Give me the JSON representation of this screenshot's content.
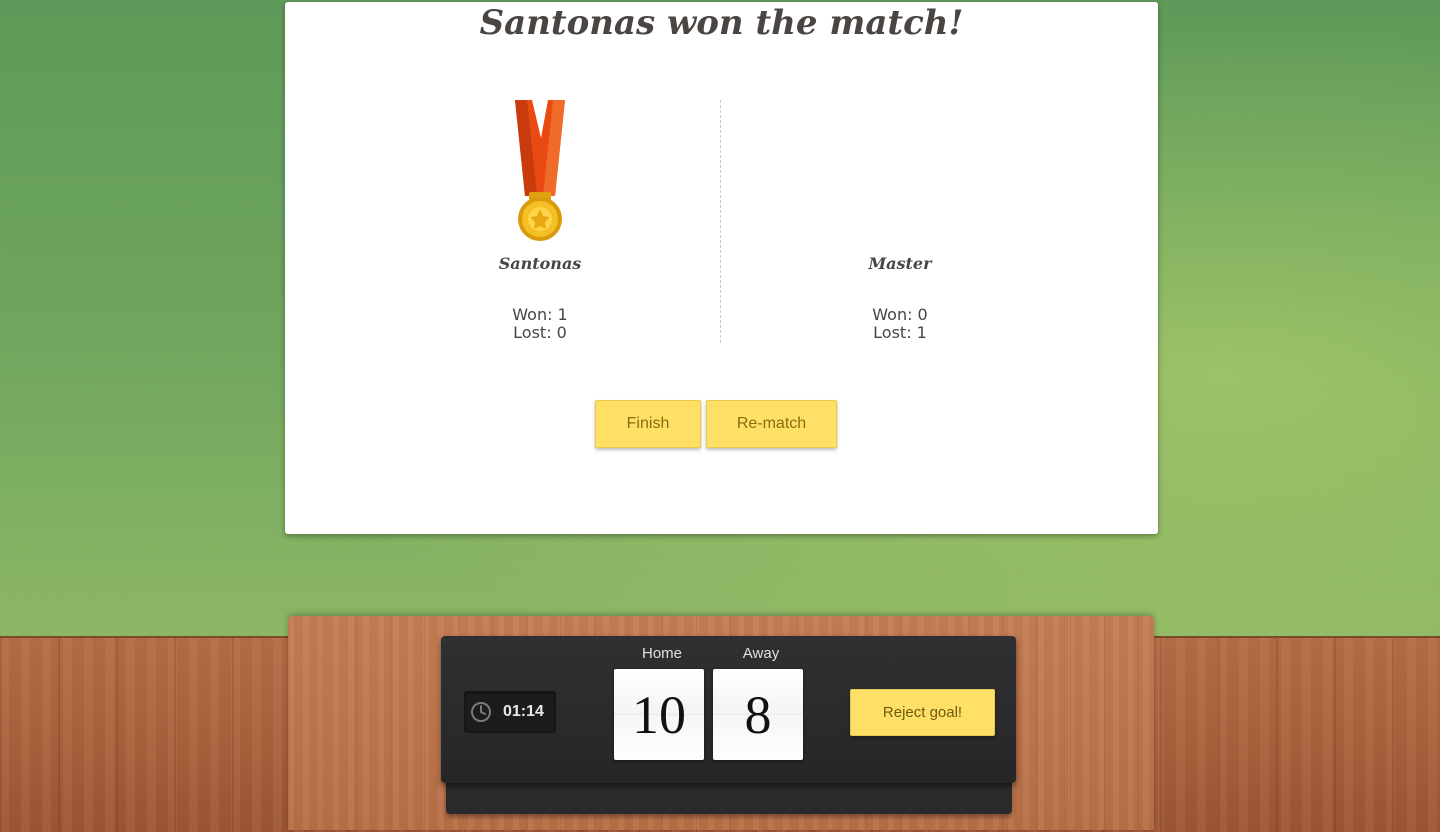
{
  "modal": {
    "title": "Santonas won the match!",
    "players": [
      {
        "name": "Santonas",
        "won": "Won: 1",
        "lost": "Lost: 0",
        "winner": true
      },
      {
        "name": "Master",
        "won": "Won: 0",
        "lost": "Lost: 1",
        "winner": false
      }
    ],
    "buttons": {
      "finish": "Finish",
      "rematch": "Re-match"
    }
  },
  "scoreboard": {
    "timer": "01:14",
    "home_label": "Home",
    "away_label": "Away",
    "home_score": "10",
    "away_score": "8",
    "reject_label": "Reject goal!"
  },
  "colors": {
    "button": "#ffe066",
    "medal_ribbon": "#e84a12",
    "medal_gold": "#f2b619",
    "background_green": "#6fa65e",
    "wood": "#b26a45"
  },
  "icons": {
    "medal": "gold-medal-icon",
    "clock": "clock-icon"
  }
}
